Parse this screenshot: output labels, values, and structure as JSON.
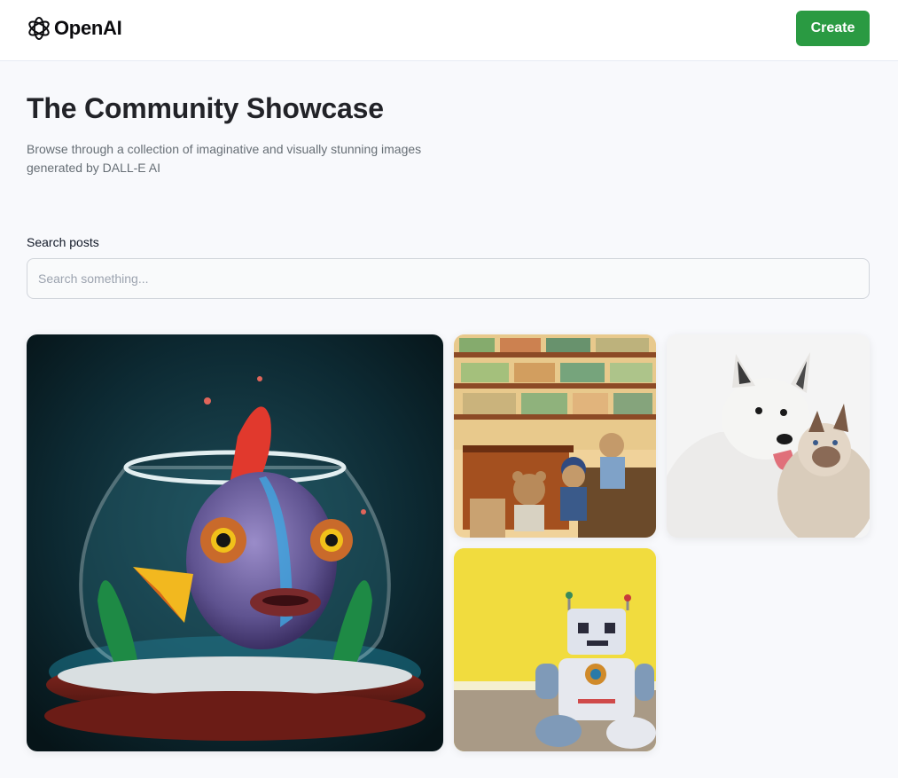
{
  "header": {
    "brand": "OpenAI",
    "create_label": "Create"
  },
  "hero": {
    "title": "The Community Showcase",
    "subtitle": "Browse through a collection of imaginative and visually stunning images generated by DALL-E AI"
  },
  "search": {
    "label": "Search posts",
    "placeholder": "Search something...",
    "value": ""
  },
  "gallery": {
    "items": [
      {
        "subject": "fish in a fishbowl"
      },
      {
        "subject": "teddy bears shopping in a grocery store"
      },
      {
        "subject": "husky and siamese cat cuddling"
      },
      {
        "subject": "plush robot sitting against a yellow wall"
      }
    ]
  },
  "colors": {
    "accent": "#2a9a42",
    "background": "#f8f9fc",
    "title": "#222328",
    "subtitle": "#666e75"
  }
}
